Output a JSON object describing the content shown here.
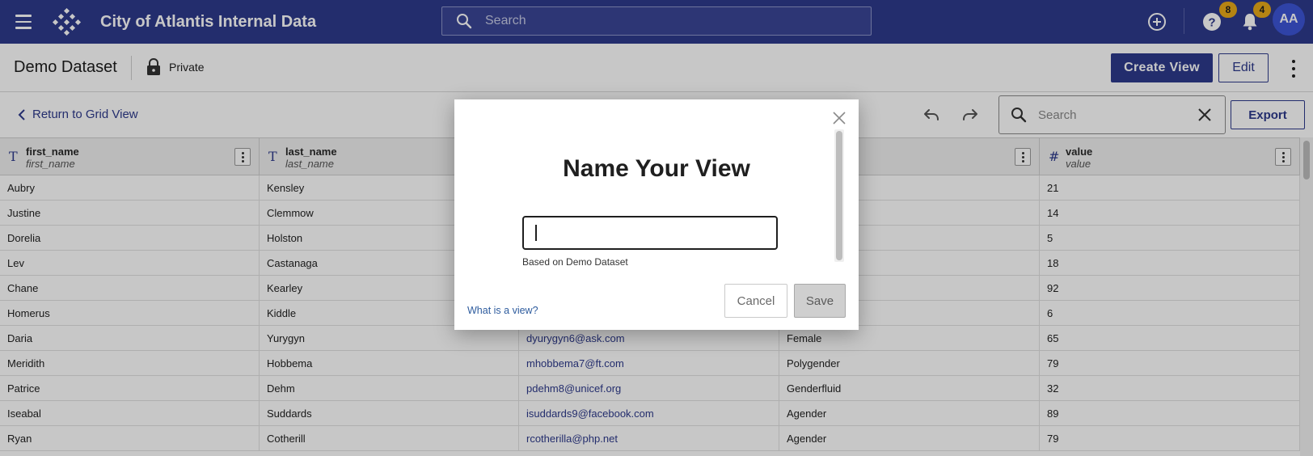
{
  "app": {
    "title": "City of Atlantis Internal Data",
    "search_placeholder": "Search",
    "help_badge": "8",
    "notifications_badge": "4",
    "avatar_initials": "AA"
  },
  "dataset": {
    "title": "Demo Dataset",
    "visibility": "Private",
    "create_view_label": "Create View",
    "edit_label": "Edit"
  },
  "toolbar": {
    "return_label": "Return to Grid View",
    "search_placeholder": "Search",
    "export_label": "Export"
  },
  "grid": {
    "columns": [
      {
        "type_icon": "T",
        "name": "first_name",
        "sub": "first_name"
      },
      {
        "type_icon": "T",
        "name": "last_name",
        "sub": "last_name"
      },
      {
        "type_icon": "",
        "name": "",
        "sub": ""
      },
      {
        "type_icon": "",
        "name": "",
        "sub": ""
      },
      {
        "type_icon": "#",
        "name": "value",
        "sub": "value"
      }
    ],
    "rows": [
      [
        "Aubry",
        "Kensley",
        "",
        "",
        "21"
      ],
      [
        "Justine",
        "Clemmow",
        "",
        "",
        "14"
      ],
      [
        "Dorelia",
        "Holston",
        "",
        "",
        "5"
      ],
      [
        "Lev",
        "Castanaga",
        "",
        "",
        "18"
      ],
      [
        "Chane",
        "Kearley",
        "",
        "",
        "92"
      ],
      [
        "Homerus",
        "Kiddle",
        "",
        "",
        "6"
      ],
      [
        "Daria",
        "Yurygyn",
        "dyurygyn6@ask.com",
        "Female",
        "65"
      ],
      [
        "Meridith",
        "Hobbema",
        "mhobbema7@ft.com",
        "Polygender",
        "79"
      ],
      [
        "Patrice",
        "Dehm",
        "pdehm8@unicef.org",
        "Genderfluid",
        "32"
      ],
      [
        "Iseabal",
        "Suddards",
        "isuddards9@facebook.com",
        "Agender",
        "89"
      ],
      [
        "Ryan",
        "Cotherill",
        "rcotherilla@php.net",
        "Agender",
        "79"
      ]
    ]
  },
  "modal": {
    "title": "Name Your View",
    "input_value": "",
    "helper_text": "Based on Demo Dataset",
    "what_link": "What is a view?",
    "cancel_label": "Cancel",
    "save_label": "Save"
  },
  "colors": {
    "brand": "#2e3a8c",
    "badge": "#e8a919",
    "avatar": "#3d55d6"
  }
}
